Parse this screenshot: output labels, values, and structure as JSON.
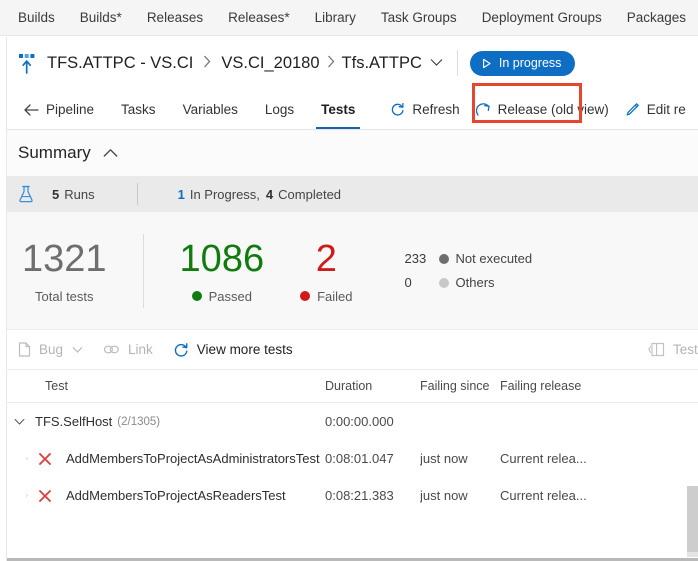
{
  "hub_nav": {
    "items": [
      {
        "label": "Builds"
      },
      {
        "label": "Builds*"
      },
      {
        "label": "Releases"
      },
      {
        "label": "Releases*"
      },
      {
        "label": "Library"
      },
      {
        "label": "Task Groups"
      },
      {
        "label": "Deployment Groups"
      },
      {
        "label": "Packages"
      }
    ]
  },
  "breadcrumb": {
    "release_icon": "release-pipeline-icon",
    "pipeline_name": "TFS.ATTPC - VS.CI",
    "separator": "›",
    "release_name": "VS.CI_20180",
    "stage_name": "Tfs.ATTPC",
    "stage_caret_icon": "chevron-down-icon",
    "status_pill": {
      "label": "In progress",
      "icon": "play-icon",
      "color": "#0e6ec4"
    },
    "highlight_color": "#e8462c"
  },
  "tabs": {
    "back_label": "Pipeline",
    "back_icon": "arrow-left-icon",
    "items": [
      {
        "label": "Tasks",
        "selected": false
      },
      {
        "label": "Variables",
        "selected": false
      },
      {
        "label": "Logs",
        "selected": false
      },
      {
        "label": "Tests",
        "selected": true
      }
    ],
    "actions": [
      {
        "label": "Refresh",
        "icon": "refresh-icon"
      },
      {
        "label": "Release (old view)",
        "icon": "external-arrow-icon"
      },
      {
        "label": "Edit re",
        "icon": "pencil-icon"
      }
    ],
    "accent_color": "#1565a8"
  },
  "summary": {
    "title": "Summary",
    "collapse_icon": "chevron-up-icon",
    "runs": {
      "icon": "flask-icon",
      "count": "5",
      "label": "Runs",
      "in_progress_count": "1",
      "in_progress_label": "In Progress,",
      "completed_count": "4",
      "completed_label": "Completed"
    },
    "stats": {
      "total": {
        "value": "1321",
        "label": "Total tests"
      },
      "passed": {
        "value": "1086",
        "label": "Passed",
        "color": "#107c10"
      },
      "failed": {
        "value": "2",
        "label": "Failed",
        "color": "#d11b1b"
      },
      "minor": [
        {
          "value": "233",
          "label": "Not executed",
          "color": "#6e6e6e"
        },
        {
          "value": "0",
          "label": "Others",
          "color": "#c8c8c8"
        }
      ]
    }
  },
  "results_toolbar": {
    "bug": {
      "label": "Bug",
      "icon": "bug-file-icon",
      "caret_icon": "chevron-down-icon"
    },
    "link": {
      "label": "Link",
      "icon": "link-icon"
    },
    "view_more": {
      "label": "View more tests",
      "icon": "refresh-icon"
    },
    "test_runs": {
      "label": "Test r",
      "icon": "panel-icon"
    }
  },
  "table": {
    "columns": [
      {
        "key": "test",
        "label": "Test"
      },
      {
        "key": "duration",
        "label": "Duration"
      },
      {
        "key": "failing_since",
        "label": "Failing since"
      },
      {
        "key": "failing_release",
        "label": "Failing release"
      }
    ],
    "rows": [
      {
        "type": "group",
        "expander_icon": "chevron-down-icon",
        "name": "TFS.SelfHost",
        "count": "(2/1305)",
        "duration": "0:00:00.000",
        "failing_since": "",
        "failing_release": ""
      },
      {
        "type": "test",
        "expander_icon": "chevron-right-icon",
        "status_icon": "x-fail-icon",
        "name": "AddMembersToProjectAsAdministratorsTest",
        "duration": "0:08:01.047",
        "failing_since": "just now",
        "failing_release": "Current relea..."
      },
      {
        "type": "test",
        "expander_icon": "chevron-right-icon",
        "status_icon": "x-fail-icon",
        "name": "AddMembersToProjectAsReadersTest",
        "duration": "0:08:21.383",
        "failing_since": "just now",
        "failing_release": "Current relea..."
      }
    ]
  }
}
